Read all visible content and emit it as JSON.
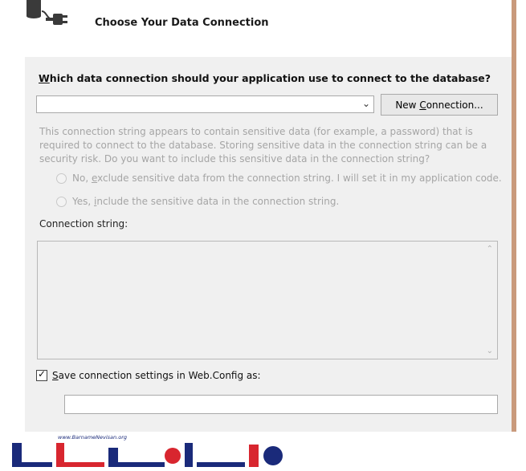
{
  "header": {
    "title": "Choose Your Data Connection",
    "icon": "database-plug-icon"
  },
  "question": {
    "accel": "W",
    "rest": "hich data connection should your application use to connect to the database?"
  },
  "connection_select": {
    "value": "",
    "icon": "chevron-down-icon"
  },
  "new_connection_button": {
    "before": "New ",
    "accel": "C",
    "after": "onnection..."
  },
  "sensitive_note": "This connection string appears to contain sensitive data (for example, a password) that is required to connect to the database. Storing sensitive data in the connection string can be a security risk. Do you want to include this sensitive data in the connection string?",
  "options": [
    {
      "before": "No, ",
      "accel": "e",
      "after": "xclude sensitive data from the connection string. I will set it in my application code."
    },
    {
      "before": "Yes, ",
      "accel": "i",
      "after": "nclude the sensitive data in the connection string."
    }
  ],
  "connection_string": {
    "label": "Connection string:",
    "value": ""
  },
  "save_settings": {
    "checked": true,
    "accel": "S",
    "after": "ave connection settings in Web.Config as:",
    "value": ""
  },
  "watermark": {
    "url": "www.BarnameNevisan.org",
    "text": "برنامه نویسان",
    "colors": {
      "blue": "#1a2a7a",
      "red": "#d8262f"
    }
  },
  "colors": {
    "panel": "#f0f0f0",
    "disabled_text": "#a5a5a5",
    "right_bar": "#c99a7c"
  }
}
